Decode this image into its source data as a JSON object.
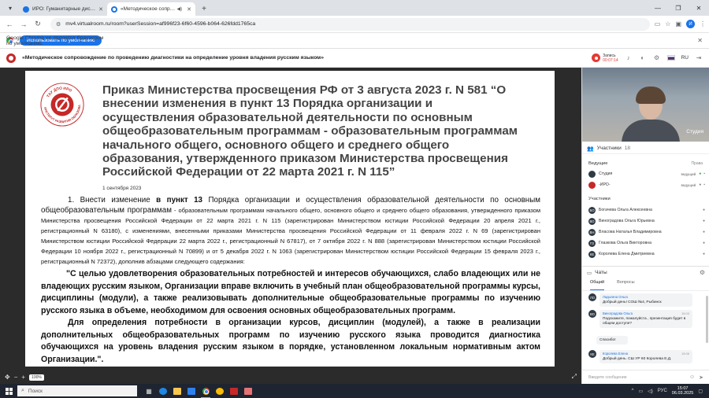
{
  "browser": {
    "tabs": [
      {
        "title": "ИРО: Гуманитарные дисципл..."
      },
      {
        "title": "«Методическое сопрово..."
      }
    ],
    "url": "mv4.virtualroom.ru/room?userSession=af996f23-6f60-4596-b064-626fdd1765ca",
    "profile_initial": "И",
    "banner_message": "Google Chrome не является браузером по умолчанию.",
    "banner_button": "Использовать по умолчанию"
  },
  "app": {
    "title": "«Методическое сопровождение по проведению диагностики на определение уровня владения русским языком»",
    "record_label": "Запись",
    "record_time": "00:07:14",
    "language": "RU"
  },
  "slide": {
    "seal_text_top": "ТАУ ДПО ИРО",
    "seal_text_bottom": "ИНСТИТУТ РАЗВИТИЯ ОБРАЗОВАНИЯ",
    "title": "Приказ Министерства просвещения РФ от 3 августа 2023 г. N 581 “О внесении изменения в пункт 13 Порядка организации и осуществления образовательной деятельности по основным общеобразовательным программам - образовательным программам начального общего, основного общего и среднего общего образования, утвержденного приказом Министерства просвещения Российской Федерации от 22 марта 2021 г. N 115”",
    "date": "1 сентября 2023",
    "p1_a": "1. Внести изменение ",
    "p1_b": "в пункт 13",
    "p1_c": " Порядка организации и осуществления образовательной деятельности по основным общеобразовательным программам",
    "p1_d": " - образовательным программам начального общего, основного общего и среднего общего образования, утвержденного приказом Министерства просвещения Российской Федерации от 22 марта 2021 г. N 115 (зарегистрирован Министерством юстиции Российской Федерации 20 апреля 2021 г., регистрационный N 63180), с изменениями, внесенными приказами Министерства просвещения Российской Федерации от 11 февраля 2022 г. N 69 (зарегистрирован Министерством юстиции Российской Федерации 22 марта 2022 г., регистрационный N 67817), от 7 октября 2022 г. N 888 (зарегистрирован Министерством юстиции Российской Федерации 10 ноября 2022 г., регистрационный N 70899) и от 5 декабря 2022 г. N 1063 (зарегистрирован Министерством юстиции Российской Федерации 15 февраля 2023 г., регистрационный N 72372), дополнив абзацами следующего содержания:",
    "p2": "\"С целью удовлетворения образовательных потребностей и интересов обучающихся, слабо владеющих или не владеющих русским языком, Организации вправе включить в учебный план общеобразовательной программы курсы, дисциплины (модули), а также реализовывать дополнительные общеобразовательные программы по изучению русского языка в объеме, необходимом для освоения основных общеобразовательных программ.",
    "p3": "Для определения потребности в организации курсов, дисциплин (модулей), а также в реализации дополнительных общеобразовательных программ по изучению русского языка проводится диагностика обучающихся на уровень владения русским языком в порядке, установленном локальным нормативным актом Организации.\".",
    "zoom": "100%"
  },
  "panel": {
    "video_label": "Студия",
    "participants_title": "Участники",
    "participants_count": "18",
    "leaders_label": "Ведущие",
    "rights_label": "Права",
    "leaders": [
      {
        "name": "Студия",
        "role": "ведущий"
      },
      {
        "name": "-ИРО-",
        "role": "ведущий"
      }
    ],
    "members_label": "Участники",
    "members": [
      {
        "initials": "БО",
        "name": "Богачева Ольга Алексеевна"
      },
      {
        "initials": "ВО",
        "name": "Виноградова Ольга Юрьевна"
      },
      {
        "initials": "ВН",
        "name": "Власова Наталья Владимировна"
      },
      {
        "initials": "ГО",
        "name": "Глазкова Ольга Викторовна"
      },
      {
        "initials": "КЕ",
        "name": "Королева Елена Дмитриевна"
      }
    ],
    "chat_title": "Чаты",
    "chat_tabs": [
      "Общий",
      "Вопросы"
    ],
    "messages": [
      {
        "initials": "ЛО",
        "author": "Ладыгина Ольга",
        "time": "",
        "text": "Добрый день! СОШ №4, Рыбинск"
      },
      {
        "initials": "ВО",
        "author": "Виноградова Ольга",
        "time": "15:03",
        "text": "Подскажите, пожалуйста , презентация будет в общем доступе?"
      },
      {
        "initials": "",
        "author": "",
        "time": "",
        "text": "Спасибо!"
      },
      {
        "initials": "КЕ",
        "author": "Королева Елена",
        "time": "15:06",
        "text": "Добрый день. СШ УР 60 Королева Е.Д."
      }
    ],
    "composer_placeholder": "Введите сообщение"
  },
  "taskbar": {
    "search_placeholder": "Поиск",
    "language": "РУС",
    "time": "15:07",
    "date": "06.03.2025"
  }
}
